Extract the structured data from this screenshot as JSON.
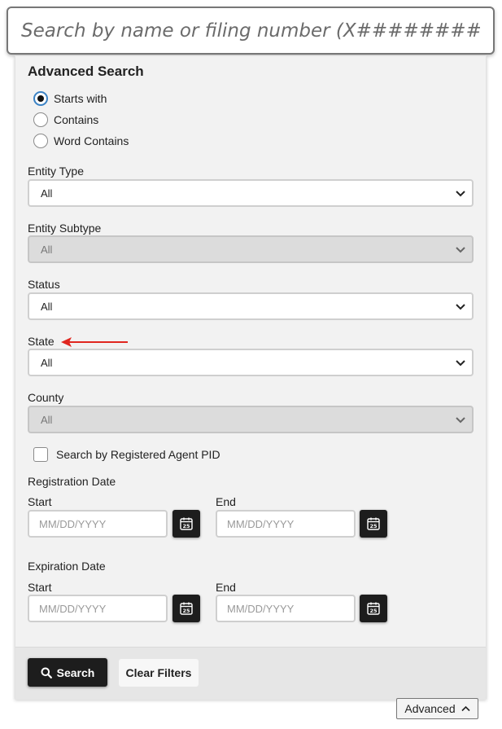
{
  "search": {
    "placeholder": "Search by name or filing number (X########)"
  },
  "advanced": {
    "title": "Advanced Search",
    "match_options": [
      {
        "label": "Starts with",
        "checked": true
      },
      {
        "label": "Contains",
        "checked": false
      },
      {
        "label": "Word Contains",
        "checked": false
      }
    ],
    "entity_type": {
      "label": "Entity Type",
      "value": "All",
      "disabled": false
    },
    "entity_subtype": {
      "label": "Entity Subtype",
      "value": "All",
      "disabled": true
    },
    "status": {
      "label": "Status",
      "value": "All",
      "disabled": false
    },
    "state": {
      "label": "State",
      "value": "All",
      "disabled": false
    },
    "county": {
      "label": "County",
      "value": "All",
      "disabled": true
    },
    "registered_agent": {
      "label": "Search by Registered Agent PID",
      "checked": false
    },
    "registration_date": {
      "label": "Registration Date",
      "start_label": "Start",
      "end_label": "End",
      "start_placeholder": "MM/DD/YYYY",
      "end_placeholder": "MM/DD/YYYY"
    },
    "expiration_date": {
      "label": "Expiration Date",
      "start_label": "Start",
      "end_label": "End",
      "start_placeholder": "MM/DD/YYYY",
      "end_placeholder": "MM/DD/YYYY"
    },
    "calendar_day": "25",
    "buttons": {
      "search": "Search",
      "clear": "Clear Filters"
    },
    "toggle_label": "Advanced"
  },
  "colors": {
    "annotation_arrow": "#e0261f",
    "radio_accent": "#3b82c4",
    "button_dark": "#1d1d1d"
  },
  "icons": {
    "search_button_icon": "search-icon",
    "calendar": "calendar-icon",
    "toggle": "chevron-up-icon",
    "select": "chevron-down-icon"
  }
}
